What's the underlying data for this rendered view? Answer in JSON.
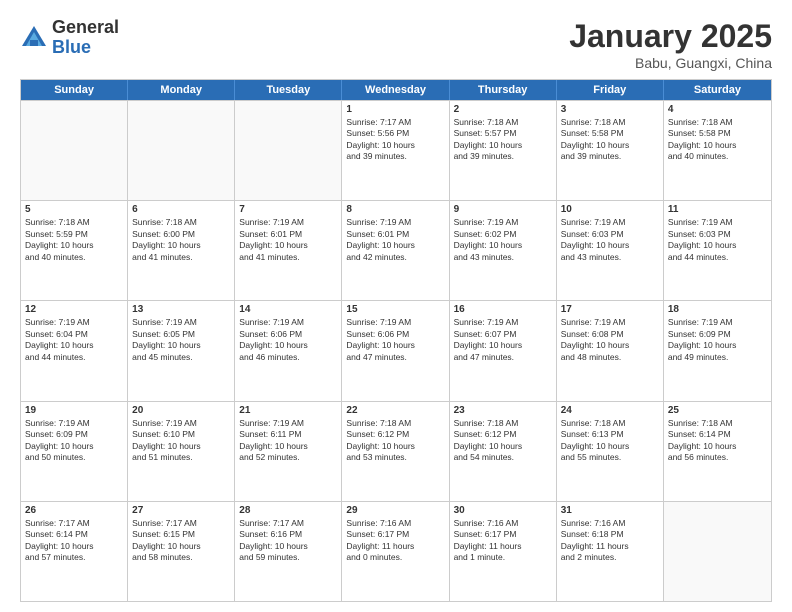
{
  "header": {
    "logo_general": "General",
    "logo_blue": "Blue",
    "title": "January 2025",
    "subtitle": "Babu, Guangxi, China"
  },
  "weekdays": [
    "Sunday",
    "Monday",
    "Tuesday",
    "Wednesday",
    "Thursday",
    "Friday",
    "Saturday"
  ],
  "weeks": [
    [
      {
        "day": "",
        "info": "",
        "empty": true
      },
      {
        "day": "",
        "info": "",
        "empty": true
      },
      {
        "day": "",
        "info": "",
        "empty": true
      },
      {
        "day": "1",
        "info": "Sunrise: 7:17 AM\nSunset: 5:56 PM\nDaylight: 10 hours\nand 39 minutes."
      },
      {
        "day": "2",
        "info": "Sunrise: 7:18 AM\nSunset: 5:57 PM\nDaylight: 10 hours\nand 39 minutes."
      },
      {
        "day": "3",
        "info": "Sunrise: 7:18 AM\nSunset: 5:58 PM\nDaylight: 10 hours\nand 39 minutes."
      },
      {
        "day": "4",
        "info": "Sunrise: 7:18 AM\nSunset: 5:58 PM\nDaylight: 10 hours\nand 40 minutes."
      }
    ],
    [
      {
        "day": "5",
        "info": "Sunrise: 7:18 AM\nSunset: 5:59 PM\nDaylight: 10 hours\nand 40 minutes."
      },
      {
        "day": "6",
        "info": "Sunrise: 7:18 AM\nSunset: 6:00 PM\nDaylight: 10 hours\nand 41 minutes."
      },
      {
        "day": "7",
        "info": "Sunrise: 7:19 AM\nSunset: 6:01 PM\nDaylight: 10 hours\nand 41 minutes."
      },
      {
        "day": "8",
        "info": "Sunrise: 7:19 AM\nSunset: 6:01 PM\nDaylight: 10 hours\nand 42 minutes."
      },
      {
        "day": "9",
        "info": "Sunrise: 7:19 AM\nSunset: 6:02 PM\nDaylight: 10 hours\nand 43 minutes."
      },
      {
        "day": "10",
        "info": "Sunrise: 7:19 AM\nSunset: 6:03 PM\nDaylight: 10 hours\nand 43 minutes."
      },
      {
        "day": "11",
        "info": "Sunrise: 7:19 AM\nSunset: 6:03 PM\nDaylight: 10 hours\nand 44 minutes."
      }
    ],
    [
      {
        "day": "12",
        "info": "Sunrise: 7:19 AM\nSunset: 6:04 PM\nDaylight: 10 hours\nand 44 minutes."
      },
      {
        "day": "13",
        "info": "Sunrise: 7:19 AM\nSunset: 6:05 PM\nDaylight: 10 hours\nand 45 minutes."
      },
      {
        "day": "14",
        "info": "Sunrise: 7:19 AM\nSunset: 6:06 PM\nDaylight: 10 hours\nand 46 minutes."
      },
      {
        "day": "15",
        "info": "Sunrise: 7:19 AM\nSunset: 6:06 PM\nDaylight: 10 hours\nand 47 minutes."
      },
      {
        "day": "16",
        "info": "Sunrise: 7:19 AM\nSunset: 6:07 PM\nDaylight: 10 hours\nand 47 minutes."
      },
      {
        "day": "17",
        "info": "Sunrise: 7:19 AM\nSunset: 6:08 PM\nDaylight: 10 hours\nand 48 minutes."
      },
      {
        "day": "18",
        "info": "Sunrise: 7:19 AM\nSunset: 6:09 PM\nDaylight: 10 hours\nand 49 minutes."
      }
    ],
    [
      {
        "day": "19",
        "info": "Sunrise: 7:19 AM\nSunset: 6:09 PM\nDaylight: 10 hours\nand 50 minutes."
      },
      {
        "day": "20",
        "info": "Sunrise: 7:19 AM\nSunset: 6:10 PM\nDaylight: 10 hours\nand 51 minutes."
      },
      {
        "day": "21",
        "info": "Sunrise: 7:19 AM\nSunset: 6:11 PM\nDaylight: 10 hours\nand 52 minutes."
      },
      {
        "day": "22",
        "info": "Sunrise: 7:18 AM\nSunset: 6:12 PM\nDaylight: 10 hours\nand 53 minutes."
      },
      {
        "day": "23",
        "info": "Sunrise: 7:18 AM\nSunset: 6:12 PM\nDaylight: 10 hours\nand 54 minutes."
      },
      {
        "day": "24",
        "info": "Sunrise: 7:18 AM\nSunset: 6:13 PM\nDaylight: 10 hours\nand 55 minutes."
      },
      {
        "day": "25",
        "info": "Sunrise: 7:18 AM\nSunset: 6:14 PM\nDaylight: 10 hours\nand 56 minutes."
      }
    ],
    [
      {
        "day": "26",
        "info": "Sunrise: 7:17 AM\nSunset: 6:14 PM\nDaylight: 10 hours\nand 57 minutes."
      },
      {
        "day": "27",
        "info": "Sunrise: 7:17 AM\nSunset: 6:15 PM\nDaylight: 10 hours\nand 58 minutes."
      },
      {
        "day": "28",
        "info": "Sunrise: 7:17 AM\nSunset: 6:16 PM\nDaylight: 10 hours\nand 59 minutes."
      },
      {
        "day": "29",
        "info": "Sunrise: 7:16 AM\nSunset: 6:17 PM\nDaylight: 11 hours\nand 0 minutes."
      },
      {
        "day": "30",
        "info": "Sunrise: 7:16 AM\nSunset: 6:17 PM\nDaylight: 11 hours\nand 1 minute."
      },
      {
        "day": "31",
        "info": "Sunrise: 7:16 AM\nSunset: 6:18 PM\nDaylight: 11 hours\nand 2 minutes."
      },
      {
        "day": "",
        "info": "",
        "empty": true
      }
    ]
  ]
}
